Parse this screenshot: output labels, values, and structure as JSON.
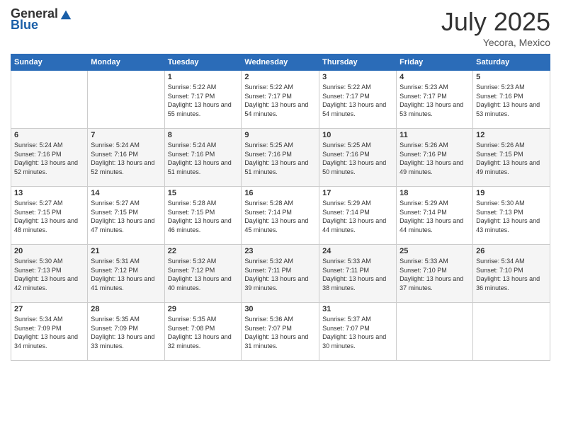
{
  "header": {
    "logo_general": "General",
    "logo_blue": "Blue",
    "month": "July 2025",
    "location": "Yecora, Mexico"
  },
  "days_of_week": [
    "Sunday",
    "Monday",
    "Tuesday",
    "Wednesday",
    "Thursday",
    "Friday",
    "Saturday"
  ],
  "weeks": [
    [
      {
        "day": "",
        "info": ""
      },
      {
        "day": "",
        "info": ""
      },
      {
        "day": "1",
        "info": "Sunrise: 5:22 AM\nSunset: 7:17 PM\nDaylight: 13 hours and 55 minutes."
      },
      {
        "day": "2",
        "info": "Sunrise: 5:22 AM\nSunset: 7:17 PM\nDaylight: 13 hours and 54 minutes."
      },
      {
        "day": "3",
        "info": "Sunrise: 5:22 AM\nSunset: 7:17 PM\nDaylight: 13 hours and 54 minutes."
      },
      {
        "day": "4",
        "info": "Sunrise: 5:23 AM\nSunset: 7:17 PM\nDaylight: 13 hours and 53 minutes."
      },
      {
        "day": "5",
        "info": "Sunrise: 5:23 AM\nSunset: 7:16 PM\nDaylight: 13 hours and 53 minutes."
      }
    ],
    [
      {
        "day": "6",
        "info": "Sunrise: 5:24 AM\nSunset: 7:16 PM\nDaylight: 13 hours and 52 minutes."
      },
      {
        "day": "7",
        "info": "Sunrise: 5:24 AM\nSunset: 7:16 PM\nDaylight: 13 hours and 52 minutes."
      },
      {
        "day": "8",
        "info": "Sunrise: 5:24 AM\nSunset: 7:16 PM\nDaylight: 13 hours and 51 minutes."
      },
      {
        "day": "9",
        "info": "Sunrise: 5:25 AM\nSunset: 7:16 PM\nDaylight: 13 hours and 51 minutes."
      },
      {
        "day": "10",
        "info": "Sunrise: 5:25 AM\nSunset: 7:16 PM\nDaylight: 13 hours and 50 minutes."
      },
      {
        "day": "11",
        "info": "Sunrise: 5:26 AM\nSunset: 7:16 PM\nDaylight: 13 hours and 49 minutes."
      },
      {
        "day": "12",
        "info": "Sunrise: 5:26 AM\nSunset: 7:15 PM\nDaylight: 13 hours and 49 minutes."
      }
    ],
    [
      {
        "day": "13",
        "info": "Sunrise: 5:27 AM\nSunset: 7:15 PM\nDaylight: 13 hours and 48 minutes."
      },
      {
        "day": "14",
        "info": "Sunrise: 5:27 AM\nSunset: 7:15 PM\nDaylight: 13 hours and 47 minutes."
      },
      {
        "day": "15",
        "info": "Sunrise: 5:28 AM\nSunset: 7:15 PM\nDaylight: 13 hours and 46 minutes."
      },
      {
        "day": "16",
        "info": "Sunrise: 5:28 AM\nSunset: 7:14 PM\nDaylight: 13 hours and 45 minutes."
      },
      {
        "day": "17",
        "info": "Sunrise: 5:29 AM\nSunset: 7:14 PM\nDaylight: 13 hours and 44 minutes."
      },
      {
        "day": "18",
        "info": "Sunrise: 5:29 AM\nSunset: 7:14 PM\nDaylight: 13 hours and 44 minutes."
      },
      {
        "day": "19",
        "info": "Sunrise: 5:30 AM\nSunset: 7:13 PM\nDaylight: 13 hours and 43 minutes."
      }
    ],
    [
      {
        "day": "20",
        "info": "Sunrise: 5:30 AM\nSunset: 7:13 PM\nDaylight: 13 hours and 42 minutes."
      },
      {
        "day": "21",
        "info": "Sunrise: 5:31 AM\nSunset: 7:12 PM\nDaylight: 13 hours and 41 minutes."
      },
      {
        "day": "22",
        "info": "Sunrise: 5:32 AM\nSunset: 7:12 PM\nDaylight: 13 hours and 40 minutes."
      },
      {
        "day": "23",
        "info": "Sunrise: 5:32 AM\nSunset: 7:11 PM\nDaylight: 13 hours and 39 minutes."
      },
      {
        "day": "24",
        "info": "Sunrise: 5:33 AM\nSunset: 7:11 PM\nDaylight: 13 hours and 38 minutes."
      },
      {
        "day": "25",
        "info": "Sunrise: 5:33 AM\nSunset: 7:10 PM\nDaylight: 13 hours and 37 minutes."
      },
      {
        "day": "26",
        "info": "Sunrise: 5:34 AM\nSunset: 7:10 PM\nDaylight: 13 hours and 36 minutes."
      }
    ],
    [
      {
        "day": "27",
        "info": "Sunrise: 5:34 AM\nSunset: 7:09 PM\nDaylight: 13 hours and 34 minutes."
      },
      {
        "day": "28",
        "info": "Sunrise: 5:35 AM\nSunset: 7:09 PM\nDaylight: 13 hours and 33 minutes."
      },
      {
        "day": "29",
        "info": "Sunrise: 5:35 AM\nSunset: 7:08 PM\nDaylight: 13 hours and 32 minutes."
      },
      {
        "day": "30",
        "info": "Sunrise: 5:36 AM\nSunset: 7:07 PM\nDaylight: 13 hours and 31 minutes."
      },
      {
        "day": "31",
        "info": "Sunrise: 5:37 AM\nSunset: 7:07 PM\nDaylight: 13 hours and 30 minutes."
      },
      {
        "day": "",
        "info": ""
      },
      {
        "day": "",
        "info": ""
      }
    ]
  ]
}
